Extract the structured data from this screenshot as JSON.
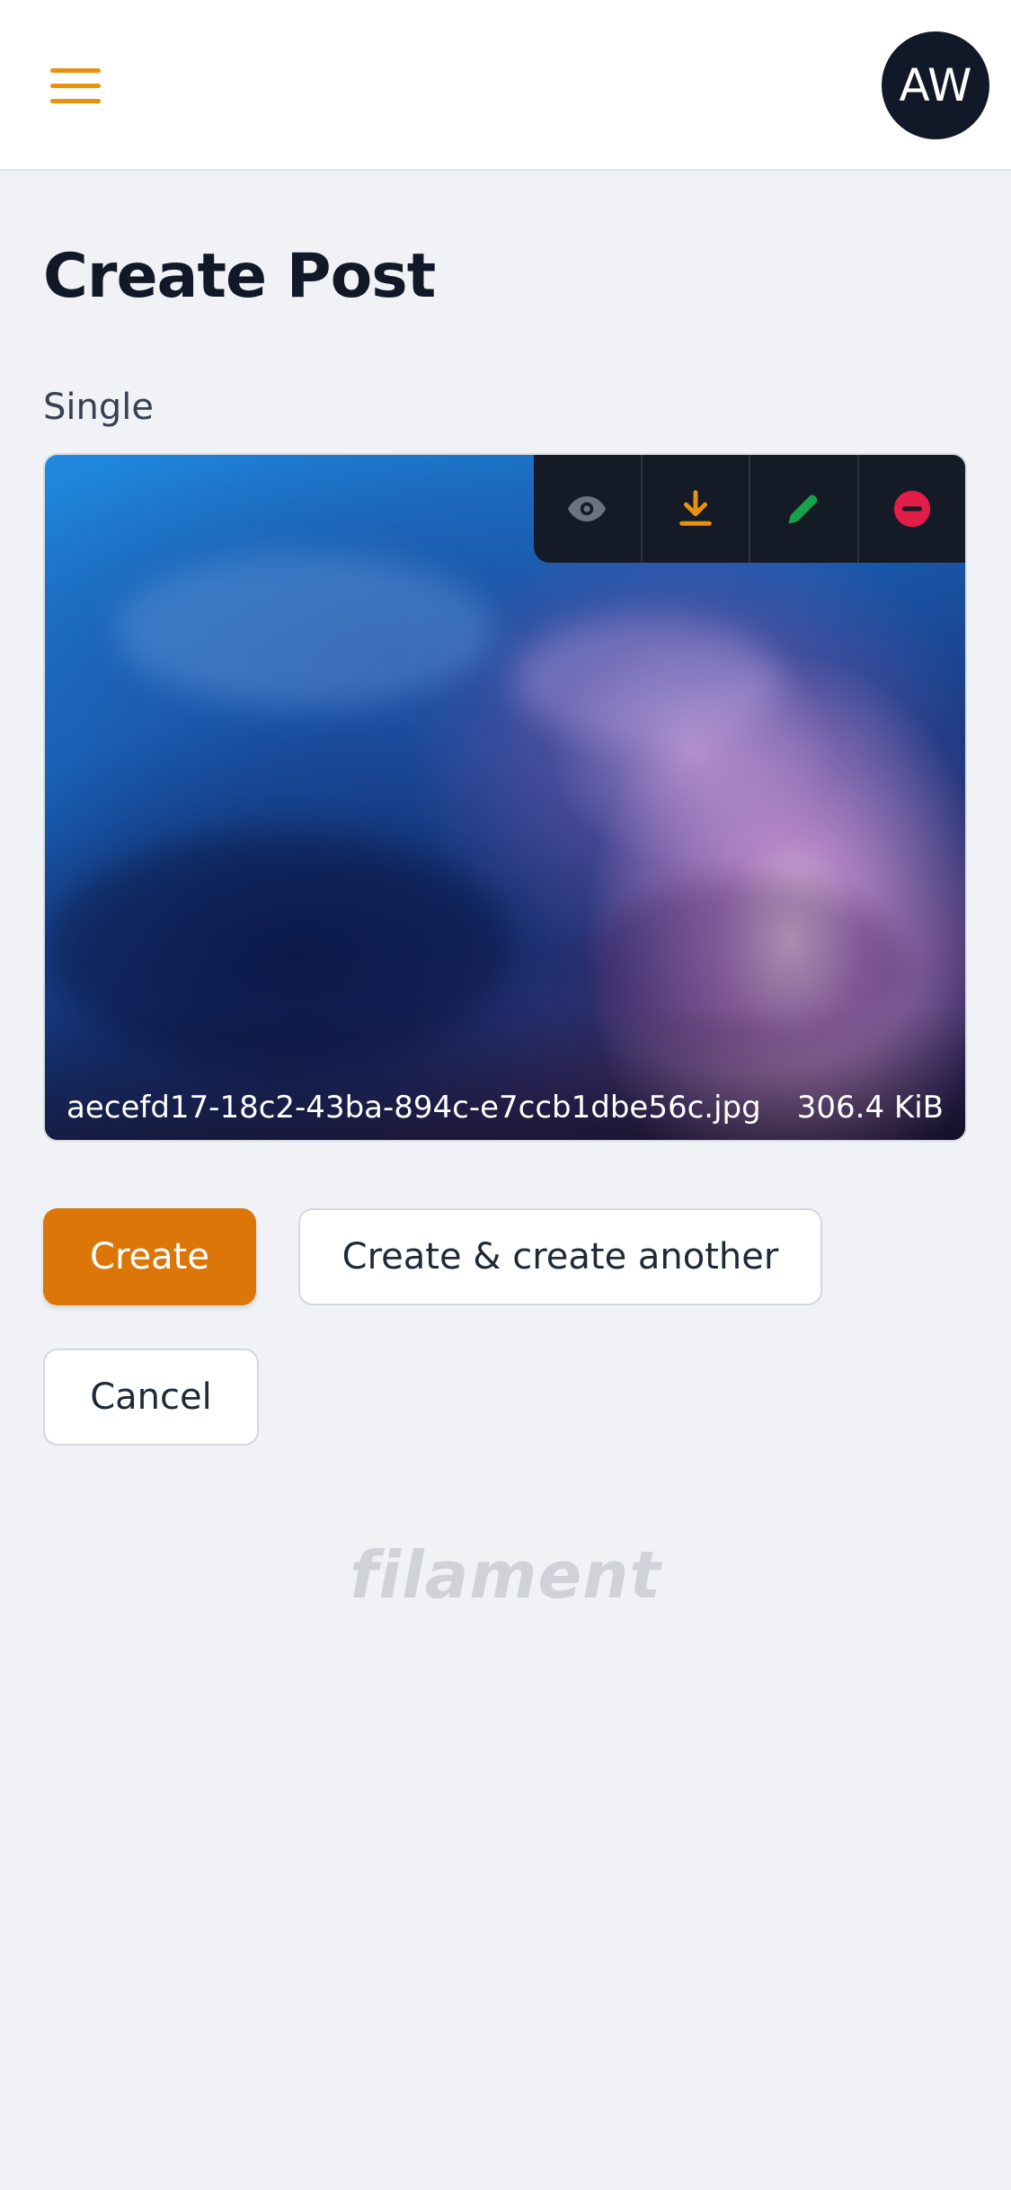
{
  "header": {
    "menu_icon": "hamburger-menu-icon",
    "avatar_initials": "AW"
  },
  "page": {
    "title": "Create Post"
  },
  "form": {
    "field_label": "Single",
    "upload": {
      "file_name": "aecefd17-18c2-43ba-894c-e7ccb1dbe56c.jpg",
      "file_size": "306.4 KiB",
      "tools": [
        {
          "name": "preview",
          "icon": "eye-icon",
          "color": "#6b7280"
        },
        {
          "name": "download",
          "icon": "download-icon",
          "color": "#e8920e"
        },
        {
          "name": "edit",
          "icon": "pencil-icon",
          "color": "#16a34a"
        },
        {
          "name": "remove",
          "icon": "minus-circle-icon",
          "color": "#e11d48"
        }
      ]
    }
  },
  "actions": {
    "create_label": "Create",
    "create_another_label": "Create & create another",
    "cancel_label": "Cancel"
  },
  "footer": {
    "logo_text": "filament"
  },
  "colors": {
    "accent": "#dd7609",
    "background": "#f1f2f5",
    "dark": "#111827"
  }
}
